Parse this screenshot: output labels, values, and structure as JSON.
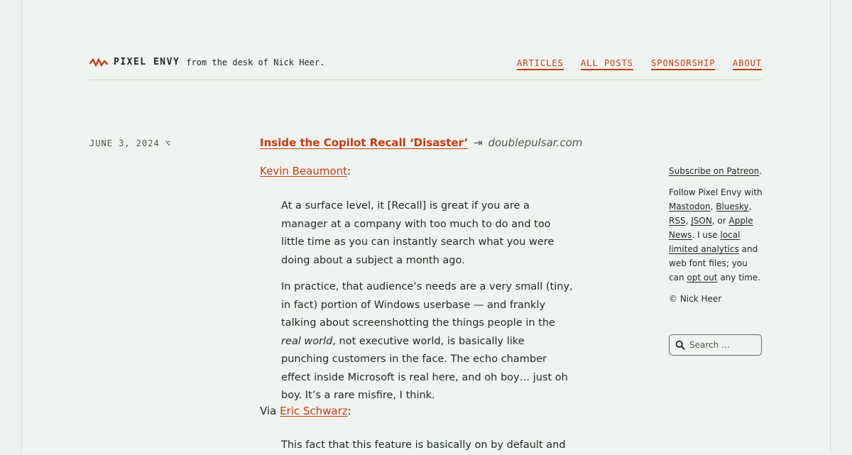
{
  "header": {
    "brand": "PIXEL ENVY",
    "tagline": "from the desk of Nick Heer.",
    "nav": [
      "ARTICLES",
      "ALL POSTS",
      "SPONSORSHIP",
      "ABOUT"
    ]
  },
  "post": {
    "date": "JUNE 3, 2024 ⌥",
    "title": "Inside the Copilot Recall ‘Disaster’",
    "arrow": "⇥",
    "domain": "doublepulsar.com",
    "author_link": "Kevin Beaumont",
    "quote_p1": "At a surface level, it [Recall] is great if you are a manager at a company with too much to do and too little time as you can instantly search what you were doing about a subject a month ago.",
    "quote_p2_a": "In practice, that audience’s needs are a very small (tiny, in fact) portion of Windows userbase — and frankly talking about screenshotting the things people in the ",
    "quote_p2_em": "real world",
    "quote_p2_b": ", not executive world, is basically like punching customers in the face. The echo chamber effect inside Microsoft is real here, and oh boy… just oh boy. It’s a rare misfire, I think.",
    "via_prefix": "Via ",
    "via_link": "Eric Schwarz",
    "next_quote": "This fact that this feature is basically on by default and"
  },
  "sidebar": {
    "subscribe": "Subscribe on Patreon",
    "follow_prefix": "Follow Pixel Envy with ",
    "mastodon": "Mastodon",
    "bluesky": "Bluesky",
    "rss": "RSS",
    "json": "JSON",
    "apple_news": "Apple News",
    "analytics_prefix": ". I use ",
    "analytics": "local limited analytics",
    "analytics_suffix": " and web font files; you can ",
    "opt_out": "opt out",
    "opt_suffix": " any time.",
    "copyright": "© Nick Heer"
  },
  "search": {
    "placeholder": "Search …"
  },
  "colors": {
    "accent": "#c83a12",
    "background": "#f0f4f0",
    "text": "#1c2a24"
  }
}
